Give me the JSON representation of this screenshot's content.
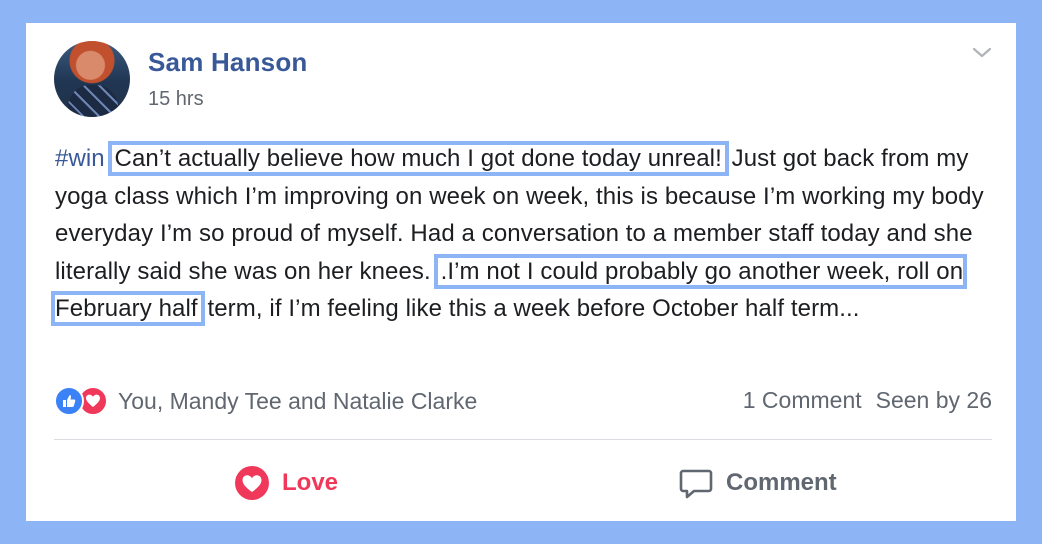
{
  "post": {
    "author": "Sam Hanson",
    "timestamp": "15 hrs",
    "hashtag": "#win",
    "text_highlight_1": "Can’t actually believe how much I got done today unreal!",
    "text_plain_1": " Just got back from my yoga class which I’m improving on week on week, this is because I’m working my body everyday I’m so proud of myself. Had a conversation to a member staff today and she literally said she was on her knees. ",
    "text_highlight_2": ".I’m not I could probably go another week, roll on February half",
    "text_plain_2": " term, if I’m feeling like this a week before October half term..."
  },
  "reactions": {
    "icons": [
      "thumbs-up-icon",
      "heart-icon"
    ],
    "names": "You, Mandy Tee and Natalie Clarke"
  },
  "stats": {
    "comments": "1 Comment",
    "seen": "Seen by 26"
  },
  "actions": {
    "love_label": "Love",
    "comment_label": "Comment"
  },
  "colors": {
    "background": "#8db4f5",
    "author_link": "#385898",
    "love": "#f0385a",
    "like": "#3b82f6"
  }
}
